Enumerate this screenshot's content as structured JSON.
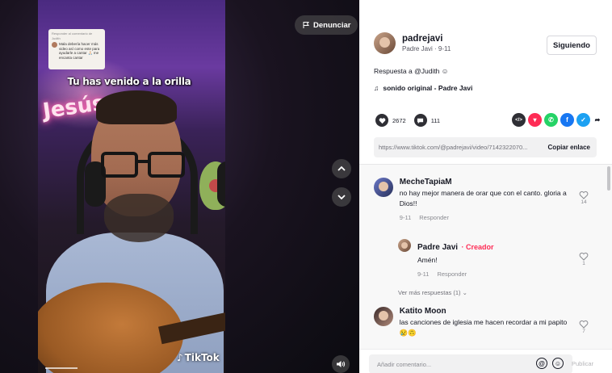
{
  "video": {
    "report_label": "Denunciar",
    "caption_overlay": "Tu has venido  a la orilla",
    "quote_card": {
      "reply_to": "Responder al comentario de Judith",
      "text": "Mala debería hacer más video así como este para ayudarle a cantar 🙏🏻 me encanta cantar"
    },
    "neon_text": "Jesús",
    "watermark": "TikTok"
  },
  "author": {
    "username": "padrejavi",
    "display_and_date": "Padre Javi · 9-11",
    "follow_label": "Siguiendo"
  },
  "description": {
    "prefix": "Respuesta a ",
    "mention": "@Judith",
    "emoji": "☺"
  },
  "music": {
    "label": "sonido original - Padre Javi"
  },
  "stats": {
    "likes": "2672",
    "comments": "111"
  },
  "share_icons": [
    {
      "name": "embed-icon",
      "color": "#2f2f35",
      "glyph": "</>"
    },
    {
      "name": "send-icon",
      "color": "#fe2c55",
      "glyph": "▼"
    },
    {
      "name": "whatsapp-icon",
      "color": "#25d366",
      "glyph": "✆"
    },
    {
      "name": "facebook-icon",
      "color": "#1877f2",
      "glyph": "f"
    },
    {
      "name": "twitter-icon",
      "color": "#1da1f2",
      "glyph": "✓"
    }
  ],
  "link": {
    "url": "https://www.tiktok.com/@padrejavi/video/7142322070...",
    "copy_label": "Copiar enlace"
  },
  "comments": [
    {
      "name": "MecheTapiaM",
      "text": "no hay mejor manera de orar que con el canto. gloria a Dios!!",
      "date": "9-11",
      "reply_label": "Responder",
      "likes": "14"
    },
    {
      "name": "Padre Javi",
      "creator_badge": "· Creador",
      "text": "Amén!",
      "date": "9-11",
      "reply_label": "Responder",
      "likes": "1"
    },
    {
      "name": "Katito Moon",
      "text": "las canciones de iglesia me hacen recordar a mi papito 😢🙃",
      "likes": "7"
    }
  ],
  "more_replies_label": "Ver más respuestas (1) ⌄",
  "comment_bar": {
    "placeholder": "Añadir comentario...",
    "post_label": "Publicar"
  },
  "colors": {
    "accent": "#fe2c55",
    "text": "#161823",
    "muted": "#8a8b91"
  }
}
